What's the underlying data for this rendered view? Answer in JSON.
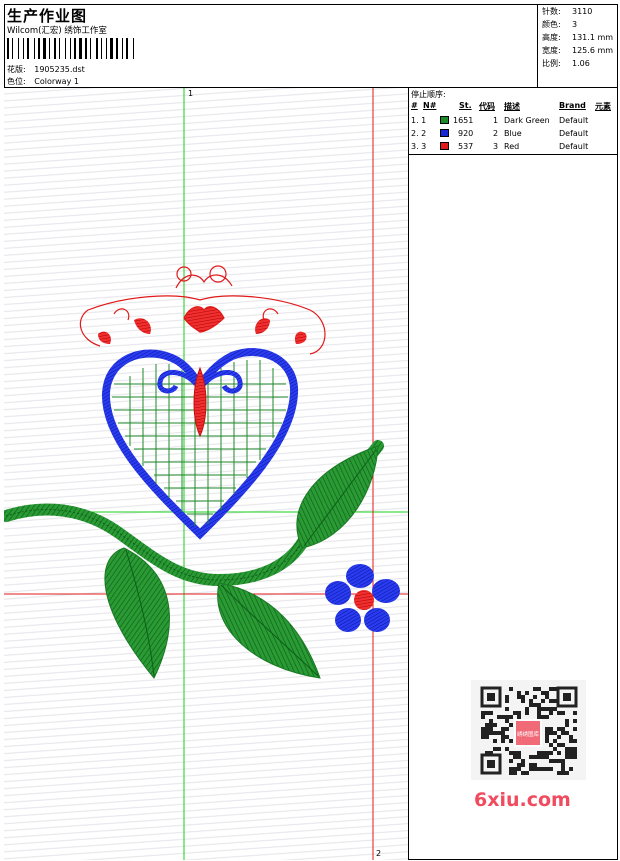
{
  "header": {
    "title": "生产作业图",
    "company": "Wilcom(汇宏) 绣饰工作室",
    "design_label": "花版:",
    "design_value": "1905235.dst",
    "colorway_label": "色位:",
    "colorway_value": "Colorway 1"
  },
  "stats": [
    {
      "label": "针数:",
      "value": "3110"
    },
    {
      "label": "颜色:",
      "value": "3"
    },
    {
      "label": "高度:",
      "value": "131.1 mm"
    },
    {
      "label": "宽度:",
      "value": "125.6 mm"
    },
    {
      "label": "比例:",
      "value": "1.06"
    }
  ],
  "guides": {
    "top_label": "1",
    "bottom_label": "2"
  },
  "stop_sequence": {
    "title": "停止顺序:",
    "headers": [
      "#",
      "N#",
      "St.",
      "代码",
      "描述",
      "Brand",
      "元素"
    ],
    "rows": [
      {
        "idx": "1. 1",
        "color": "#1d8a2a",
        "stitches": "1651",
        "code": "1",
        "desc": "Dark Green",
        "brand": "Default"
      },
      {
        "idx": "2. 2",
        "color": "#1428d6",
        "stitches": "920",
        "code": "2",
        "desc": "Blue",
        "brand": "Default"
      },
      {
        "idx": "3. 3",
        "color": "#e01a1a",
        "stitches": "537",
        "code": "3",
        "desc": "Red",
        "brand": "Default"
      }
    ]
  },
  "watermark": "6xiu.com",
  "qr_badge": "绣绣图库"
}
